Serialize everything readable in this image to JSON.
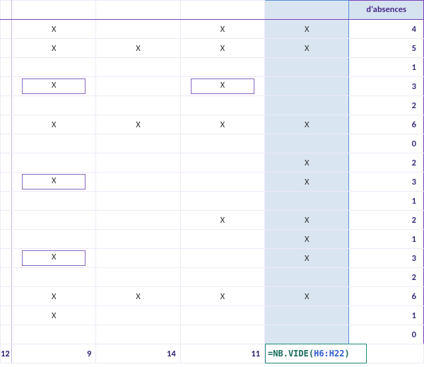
{
  "header": {
    "dates": [
      "",
      "",
      "",
      ""
    ],
    "nb_label": "d'absences"
  },
  "rows": [
    {
      "cells": [
        "X",
        "",
        "X",
        "X"
      ],
      "boxed": [
        false,
        false,
        false,
        false
      ],
      "nb": 4
    },
    {
      "cells": [
        "X",
        "X",
        "X",
        "X"
      ],
      "boxed": [
        false,
        false,
        false,
        false
      ],
      "nb": 5
    },
    {
      "cells": [
        "",
        "",
        "",
        ""
      ],
      "boxed": [
        false,
        false,
        false,
        false
      ],
      "nb": 1
    },
    {
      "cells": [
        "X",
        "",
        "X",
        ""
      ],
      "boxed": [
        true,
        false,
        true,
        false
      ],
      "nb": 3
    },
    {
      "cells": [
        "",
        "",
        "",
        ""
      ],
      "boxed": [
        false,
        false,
        false,
        false
      ],
      "nb": 2
    },
    {
      "cells": [
        "X",
        "X",
        "X",
        "X"
      ],
      "boxed": [
        false,
        false,
        false,
        false
      ],
      "nb": 6
    },
    {
      "cells": [
        "",
        "",
        "",
        ""
      ],
      "boxed": [
        false,
        false,
        false,
        false
      ],
      "nb": 0
    },
    {
      "cells": [
        "",
        "",
        "",
        "X"
      ],
      "boxed": [
        false,
        false,
        false,
        false
      ],
      "nb": 2
    },
    {
      "cells": [
        "X",
        "",
        "",
        "X"
      ],
      "boxed": [
        true,
        false,
        false,
        false
      ],
      "nb": 3
    },
    {
      "cells": [
        "",
        "",
        "",
        ""
      ],
      "boxed": [
        false,
        false,
        false,
        false
      ],
      "nb": 1
    },
    {
      "cells": [
        "",
        "",
        "X",
        "X"
      ],
      "boxed": [
        false,
        false,
        false,
        false
      ],
      "nb": 2
    },
    {
      "cells": [
        "",
        "",
        "",
        "X"
      ],
      "boxed": [
        false,
        false,
        false,
        false
      ],
      "nb": 1
    },
    {
      "cells": [
        "X",
        "",
        "",
        "X"
      ],
      "boxed": [
        true,
        false,
        false,
        false
      ],
      "nb": 3
    },
    {
      "cells": [
        "",
        "",
        "",
        ""
      ],
      "boxed": [
        false,
        false,
        false,
        false
      ],
      "nb": 2
    },
    {
      "cells": [
        "X",
        "X",
        "X",
        "X"
      ],
      "boxed": [
        false,
        false,
        false,
        false
      ],
      "nb": 6
    },
    {
      "cells": [
        "X",
        "",
        "",
        ""
      ],
      "boxed": [
        false,
        false,
        false,
        false
      ],
      "nb": 1
    },
    {
      "cells": [
        "",
        "",
        "",
        ""
      ],
      "boxed": [
        false,
        false,
        false,
        false
      ],
      "nb": 0
    }
  ],
  "totals": {
    "sliver": "12",
    "col1": "9",
    "col2": "14",
    "col3": "11"
  },
  "formula": {
    "prefix": "=",
    "fn": "NB.VIDE",
    "open": "(",
    "ref": "H6:H22",
    "close": ")"
  }
}
